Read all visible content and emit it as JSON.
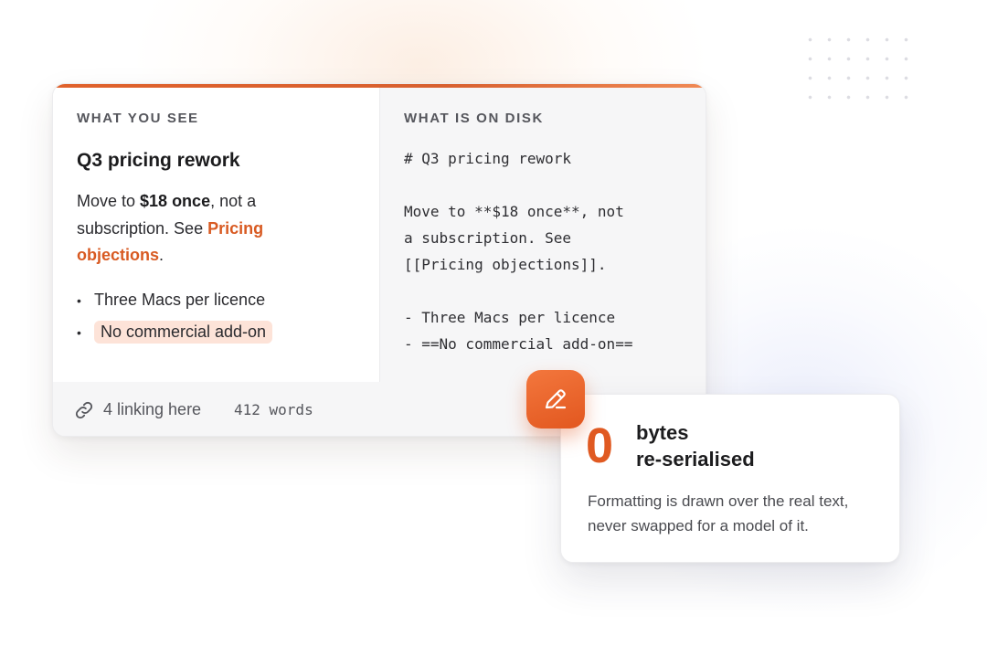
{
  "editor_card": {
    "left_label": "WHAT YOU SEE",
    "right_label": "WHAT IS ON DISK",
    "rendered": {
      "title": "Q3 pricing rework",
      "para_prefix": "Move to ",
      "para_bold": "$18 once",
      "para_middle": ", not a subscription. See ",
      "para_link": "Pricing objections",
      "para_suffix": ".",
      "bullets": [
        "Three Macs per licence",
        "No commercial add-on"
      ]
    },
    "markdown_lines": [
      "# Q3 pricing rework",
      "",
      "Move to **$18 once**, not",
      "a subscription. See",
      "[[Pricing objections]].",
      "",
      "- Three Macs per licence",
      "- ==No commercial add-on=="
    ],
    "footer": {
      "links": "4 linking here",
      "words": "412 words",
      "link_icon": "link-icon"
    }
  },
  "badge": {
    "icon": "pen-icon"
  },
  "stat_card": {
    "number": "0",
    "label_line1": "bytes",
    "label_line2": "re-serialised",
    "description": "Formatting is drawn over the real text, never swapped for a model of it."
  },
  "colors": {
    "accent": "#e05a22",
    "highlight": "#fde3d8"
  }
}
